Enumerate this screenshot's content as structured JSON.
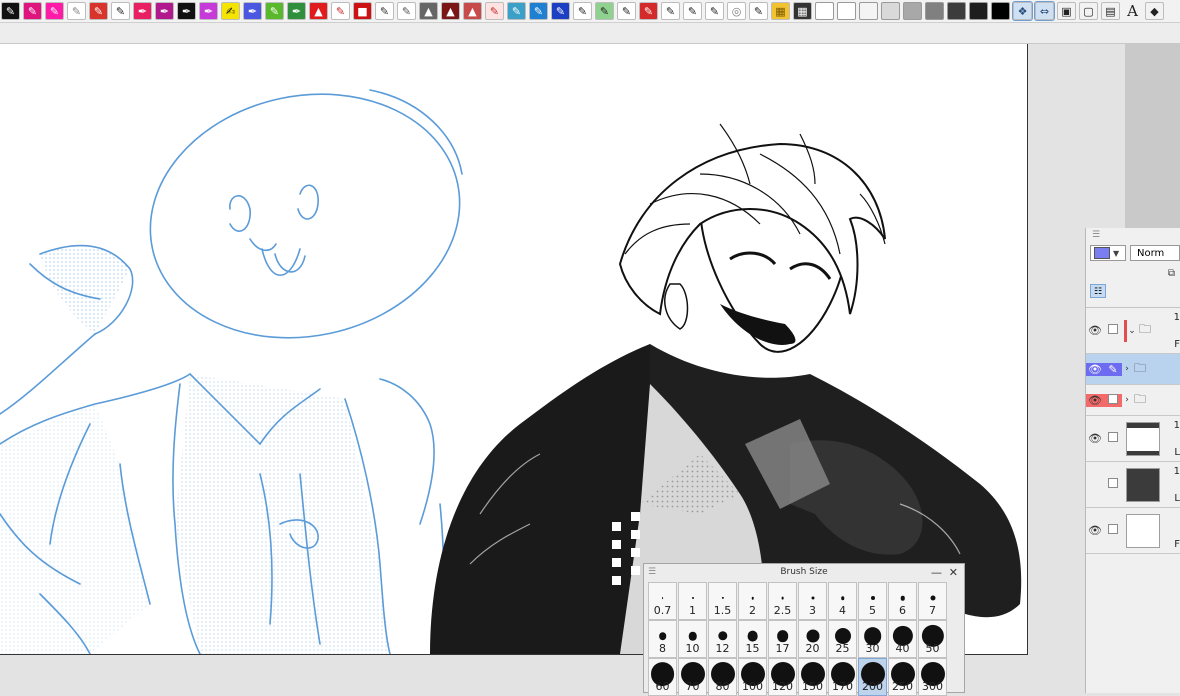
{
  "toolbar": {
    "buttons": [
      {
        "icon": "pen-icon",
        "bg": "#111111",
        "fg": "#ffffff",
        "glyph": "✎"
      },
      {
        "icon": "pen-icon",
        "bg": "#e0147f",
        "fg": "#ffffff",
        "glyph": "✎"
      },
      {
        "icon": "pen-icon",
        "bg": "#ff1aa8",
        "fg": "#ffffff",
        "glyph": "✎"
      },
      {
        "icon": "pen-icon",
        "bg": "#ffffff",
        "fg": "#888888",
        "glyph": "✎"
      },
      {
        "icon": "marker-icon",
        "bg": "#d9342b",
        "fg": "#ffffff",
        "glyph": "✎"
      },
      {
        "icon": "pen-icon",
        "bg": "#ffffff",
        "fg": "#222222",
        "glyph": "✎"
      },
      {
        "icon": "pen-nib-icon",
        "bg": "#e81f63",
        "fg": "#ffffff",
        "glyph": "✒"
      },
      {
        "icon": "pen-nib-icon",
        "bg": "#b01a8c",
        "fg": "#ffffff",
        "glyph": "✒"
      },
      {
        "icon": "pen-nib-icon",
        "bg": "#111111",
        "fg": "#ffffff",
        "glyph": "✒"
      },
      {
        "icon": "pen-nib-icon",
        "bg": "#c63ad9",
        "fg": "#ffffff",
        "glyph": "✒"
      },
      {
        "icon": "brush-icon",
        "bg": "#f5e400",
        "fg": "#111111",
        "glyph": "✍"
      },
      {
        "icon": "pen-nib-icon",
        "bg": "#4b57e0",
        "fg": "#ffffff",
        "glyph": "✒"
      },
      {
        "icon": "marker-icon",
        "bg": "#5ab82c",
        "fg": "#ffffff",
        "glyph": "✎"
      },
      {
        "icon": "pen-nib-icon",
        "bg": "#2f8f3c",
        "fg": "#ffffff",
        "glyph": "✒"
      },
      {
        "icon": "triangle-icon",
        "bg": "#e01c1c",
        "fg": "#ffffff",
        "glyph": "▲"
      },
      {
        "icon": "pencil-icon",
        "bg": "#ffffff",
        "fg": "#c62828",
        "glyph": "✎"
      },
      {
        "icon": "square-icon",
        "bg": "#cc1212",
        "fg": "#ffffff",
        "glyph": "■"
      },
      {
        "icon": "pencil-icon",
        "bg": "#ffffff",
        "fg": "#333333",
        "glyph": "✎"
      },
      {
        "icon": "pencil-icon",
        "bg": "#ffffff",
        "fg": "#555555",
        "glyph": "✎"
      },
      {
        "icon": "cat-icon",
        "bg": "#666666",
        "fg": "#ffffff",
        "glyph": "▲"
      },
      {
        "icon": "cat-icon",
        "bg": "#7a1616",
        "fg": "#ffffff",
        "glyph": "▲"
      },
      {
        "icon": "cat-icon",
        "bg": "#c84b4b",
        "fg": "#ffffff",
        "glyph": "▲"
      },
      {
        "icon": "pencil-icon",
        "bg": "#ffe3e3",
        "fg": "#c62828",
        "glyph": "✎"
      },
      {
        "icon": "pencil-icon",
        "bg": "#3aa0c8",
        "fg": "#ffffff",
        "glyph": "✎"
      },
      {
        "icon": "pencil-icon",
        "bg": "#1f7fd0",
        "fg": "#ffffff",
        "glyph": "✎"
      },
      {
        "icon": "pencil-icon",
        "bg": "#1d3fc4",
        "fg": "#ffffff",
        "glyph": "✎"
      },
      {
        "icon": "pencil-icon",
        "bg": "#ffffff",
        "fg": "#222222",
        "glyph": "✎"
      },
      {
        "icon": "pencil-icon",
        "bg": "#8fd18f",
        "fg": "#222222",
        "glyph": "✎"
      },
      {
        "icon": "pencil-icon",
        "bg": "#ffffff",
        "fg": "#222222",
        "glyph": "✎"
      },
      {
        "icon": "pencil-icon",
        "bg": "#d52a2a",
        "fg": "#ffffff",
        "glyph": "✎"
      },
      {
        "icon": "pencil-icon",
        "bg": "#ffffff",
        "fg": "#222222",
        "glyph": "✎"
      },
      {
        "icon": "pencil-icon",
        "bg": "#ffffff",
        "fg": "#222222",
        "glyph": "✎"
      },
      {
        "icon": "pencil-icon",
        "bg": "#ffffff",
        "fg": "#222222",
        "glyph": "✎"
      },
      {
        "icon": "blur-icon",
        "bg": "#ffffff",
        "fg": "#777777",
        "glyph": "◎"
      },
      {
        "icon": "pencil-icon",
        "bg": "#ffffff",
        "fg": "#222222",
        "glyph": "✎"
      },
      {
        "icon": "tone-pattern-icon",
        "bg": "#f2c230",
        "fg": "#7a5a00",
        "glyph": "▦"
      },
      {
        "icon": "tone-pattern-icon",
        "bg": "#333333",
        "fg": "#ffffff",
        "glyph": "▦"
      },
      {
        "icon": "color-swatch-icon",
        "bg": "#ffffff",
        "fg": "#ffffff",
        "glyph": ""
      },
      {
        "icon": "color-swatch-icon",
        "bg": "#ffffff",
        "fg": "#ffffff",
        "glyph": ""
      },
      {
        "icon": "color-swatch-icon",
        "bg": "#f4f4f4",
        "fg": "#ffffff",
        "glyph": ""
      },
      {
        "icon": "color-swatch-icon",
        "bg": "#d9d9d9",
        "fg": "#ffffff",
        "glyph": ""
      },
      {
        "icon": "color-swatch-icon",
        "bg": "#a8a8a8",
        "fg": "#ffffff",
        "glyph": ""
      },
      {
        "icon": "color-swatch-icon",
        "bg": "#808080",
        "fg": "#ffffff",
        "glyph": ""
      },
      {
        "icon": "color-swatch-icon",
        "bg": "#3c3c3c",
        "fg": "#ffffff",
        "glyph": ""
      },
      {
        "icon": "color-swatch-icon",
        "bg": "#1e1e1e",
        "fg": "#ffffff",
        "glyph": ""
      },
      {
        "icon": "color-swatch-icon",
        "bg": "#000000",
        "fg": "#ffffff",
        "glyph": ""
      },
      {
        "icon": "layers-icon",
        "bg": "#cfe0f3",
        "fg": "#2a4d7a",
        "glyph": "❖",
        "selected": true
      },
      {
        "icon": "transform-icon",
        "bg": "#cfe0f3",
        "fg": "#2a4d7a",
        "glyph": "⇔",
        "selected": true
      },
      {
        "icon": "animation-icon",
        "bg": "#f2f2f2",
        "fg": "#222222",
        "glyph": "▣"
      },
      {
        "icon": "window-icon",
        "bg": "#f2f2f2",
        "fg": "#222222",
        "glyph": "▢"
      },
      {
        "icon": "save-icon",
        "bg": "#f2f2f2",
        "fg": "#222222",
        "glyph": "▤"
      },
      {
        "icon": "text-tool-icon",
        "bg": "#f2f2f2",
        "fg": "#222222",
        "glyph": "A",
        "letter": true
      },
      {
        "icon": "eraser-icon",
        "bg": "#f2f2f2",
        "fg": "#222222",
        "glyph": "◆"
      }
    ]
  },
  "layer_panel": {
    "color_chip": "#7a7ef0",
    "blend_mode": "Norm",
    "layers": [
      {
        "kind": "folder",
        "visible": true,
        "expanded": true,
        "label_top": "1",
        "label_bottom": "F",
        "red_bar": true,
        "tall": true
      },
      {
        "kind": "folder",
        "visible": true,
        "selected": true,
        "expanded": false,
        "label_top": "",
        "label_bottom": ""
      },
      {
        "kind": "folder",
        "visible": true,
        "red": true,
        "expanded": false,
        "label_top": "",
        "label_bottom": ""
      },
      {
        "kind": "raster",
        "visible": true,
        "thumb": "bars",
        "label_top": "1",
        "label_bottom": "L",
        "tall": true
      },
      {
        "kind": "raster",
        "visible": false,
        "thumb": "dark",
        "label_top": "1",
        "label_bottom": "L",
        "tall": true
      },
      {
        "kind": "raster",
        "visible": true,
        "thumb": "white",
        "label_top": "",
        "label_bottom": "F",
        "tall": true
      }
    ]
  },
  "brush_size_panel": {
    "title": "Brush Size",
    "minimize_label": "—",
    "close_label": "✕",
    "active": "200",
    "sizes": [
      [
        "0.7",
        "1",
        "1.5",
        "2",
        "2.5",
        "3",
        "4",
        "5",
        "6",
        "7"
      ],
      [
        "8",
        "10",
        "12",
        "15",
        "17",
        "20",
        "25",
        "30",
        "40",
        "50"
      ],
      [
        "60",
        "70",
        "80",
        "100",
        "120",
        "150",
        "170",
        "200",
        "250",
        "300"
      ]
    ]
  }
}
